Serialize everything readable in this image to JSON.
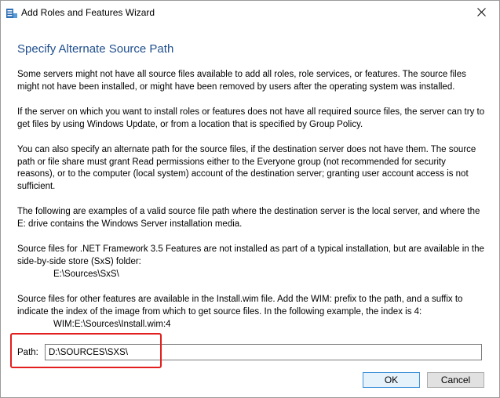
{
  "window": {
    "title": "Add Roles and Features Wizard",
    "icon": "server-manager-icon",
    "close_icon": "close-icon"
  },
  "heading": "Specify Alternate Source Path",
  "paragraphs": {
    "p1": "Some servers might not have all source files available to add all roles, role services, or features. The source files might not have been installed, or might have been removed by users after the operating system was installed.",
    "p2": "If the server on which you want to install roles or features does not have all required source files, the server can try to get files by using Windows Update, or from a location that is specified by Group Policy.",
    "p3": "You can also specify an alternate path for the source files, if the destination server does not have them. The source path or file share must grant Read permissions either to the Everyone group (not recommended for security reasons), or to the computer (local system) account of the destination server; granting user account access is not sufficient.",
    "p4": "The following are examples of a valid source file path where the destination server is the local server, and where the E: drive contains the Windows Server installation media.",
    "p5": "Source files for .NET Framework 3.5 Features are not installed as part of a typical installation, but are available in the side-by-side store (SxS) folder:",
    "example1": "E:\\Sources\\SxS\\",
    "p6": "Source files for other features are available in the Install.wim file. Add the WIM: prefix to the path, and a suffix to indicate the index of the image from which to get source files. In the following example, the index is 4:",
    "example2": "WIM:E:\\Sources\\Install.wim:4"
  },
  "path": {
    "label": "Path:",
    "value": "D:\\SOURCES\\SXS\\"
  },
  "highlight_color": "#e21e1e",
  "heading_color": "#1e4e8c",
  "buttons": {
    "ok": "OK",
    "cancel": "Cancel"
  }
}
